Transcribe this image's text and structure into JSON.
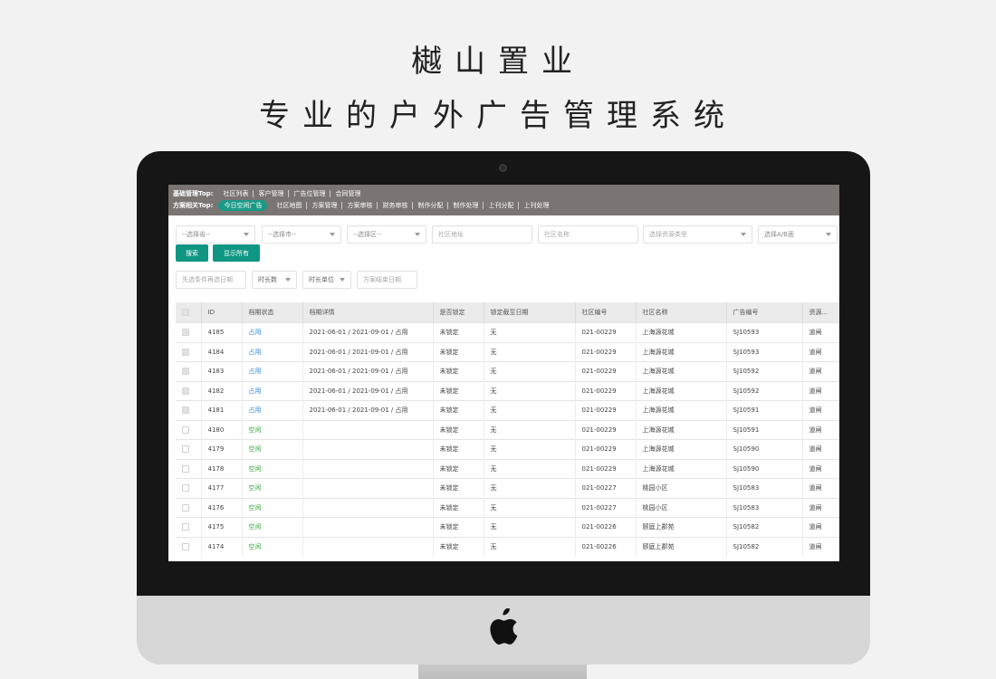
{
  "hero": {
    "title": "樾山置业",
    "subtitle": "专业的户外广告管理系统"
  },
  "colors": {
    "navbar_bg": "#7a7473",
    "accent": "#0f9683",
    "status_occupied": "#2f8ad8",
    "status_free": "#3aa83f"
  },
  "nav": {
    "row1_label": "基础管理Top:",
    "row1_links": [
      "社区列表",
      "客户管理",
      "广告位管理",
      "合同管理"
    ],
    "row2_label": "方案相关Top:",
    "row2_active": "今日空闲广告",
    "row2_links": [
      "社区地图",
      "方案管理",
      "方案审核",
      "财务审核",
      "制作分配",
      "制作处理",
      "上刊分配",
      "上刊处理"
    ]
  },
  "filters": {
    "province": "--选择省--",
    "city": "--选择市--",
    "district": "--选择区--",
    "address_placeholder": "社区地址",
    "name_placeholder": "社区名称",
    "resource_type": "选择资源类型",
    "ab_side": "选择A/B面",
    "search_button": "搜索",
    "show_all_button": "显示所有",
    "date_placeholder": "先选条件再选日期",
    "duration": "时长数",
    "duration_unit": "时长单位",
    "end_date_placeholder": "方案结束日期"
  },
  "table": {
    "columns": [
      "ID",
      "档期状态",
      "档期详情",
      "是否锁定",
      "锁定截至日期",
      "社区编号",
      "社区名称",
      "广告编号",
      "资源..."
    ],
    "rows": [
      {
        "id": "4185",
        "status": "占用",
        "detail": "2021-06-01 / 2021-09-01 / 占用",
        "locked": "未锁定",
        "lock_until": "无",
        "community_no": "021-00229",
        "community_name": "上海源花城",
        "ad_no": "SJ10593",
        "resource": "道闸",
        "selectable": false
      },
      {
        "id": "4184",
        "status": "占用",
        "detail": "2021-06-01 / 2021-09-01 / 占用",
        "locked": "未锁定",
        "lock_until": "无",
        "community_no": "021-00229",
        "community_name": "上海源花城",
        "ad_no": "SJ10593",
        "resource": "道闸",
        "selectable": false
      },
      {
        "id": "4183",
        "status": "占用",
        "detail": "2021-06-01 / 2021-09-01 / 占用",
        "locked": "未锁定",
        "lock_until": "无",
        "community_no": "021-00229",
        "community_name": "上海源花城",
        "ad_no": "SJ10592",
        "resource": "道闸",
        "selectable": false
      },
      {
        "id": "4182",
        "status": "占用",
        "detail": "2021-06-01 / 2021-09-01 / 占用",
        "locked": "未锁定",
        "lock_until": "无",
        "community_no": "021-00229",
        "community_name": "上海源花城",
        "ad_no": "SJ10592",
        "resource": "道闸",
        "selectable": false
      },
      {
        "id": "4181",
        "status": "占用",
        "detail": "2021-06-01 / 2021-09-01 / 占用",
        "locked": "未锁定",
        "lock_until": "无",
        "community_no": "021-00229",
        "community_name": "上海源花城",
        "ad_no": "SJ10591",
        "resource": "道闸",
        "selectable": false
      },
      {
        "id": "4180",
        "status": "空闲",
        "detail": "",
        "locked": "未锁定",
        "lock_until": "无",
        "community_no": "021-00229",
        "community_name": "上海源花城",
        "ad_no": "SJ10591",
        "resource": "道闸",
        "selectable": true
      },
      {
        "id": "4179",
        "status": "空闲",
        "detail": "",
        "locked": "未锁定",
        "lock_until": "无",
        "community_no": "021-00229",
        "community_name": "上海源花城",
        "ad_no": "SJ10590",
        "resource": "道闸",
        "selectable": true
      },
      {
        "id": "4178",
        "status": "空闲",
        "detail": "",
        "locked": "未锁定",
        "lock_until": "无",
        "community_no": "021-00229",
        "community_name": "上海源花城",
        "ad_no": "SJ10590",
        "resource": "道闸",
        "selectable": true
      },
      {
        "id": "4177",
        "status": "空闲",
        "detail": "",
        "locked": "未锁定",
        "lock_until": "无",
        "community_no": "021-00227",
        "community_name": "桃园小区",
        "ad_no": "SJ10583",
        "resource": "道闸",
        "selectable": true
      },
      {
        "id": "4176",
        "status": "空闲",
        "detail": "",
        "locked": "未锁定",
        "lock_until": "无",
        "community_no": "021-00227",
        "community_name": "桃园小区",
        "ad_no": "SJ10583",
        "resource": "道闸",
        "selectable": true
      },
      {
        "id": "4175",
        "status": "空闲",
        "detail": "",
        "locked": "未锁定",
        "lock_until": "无",
        "community_no": "021-00226",
        "community_name": "颐庭上郡苑",
        "ad_no": "SJ10582",
        "resource": "道闸",
        "selectable": true
      },
      {
        "id": "4174",
        "status": "空闲",
        "detail": "",
        "locked": "未锁定",
        "lock_until": "无",
        "community_no": "021-00226",
        "community_name": "颐庭上郡苑",
        "ad_no": "SJ10582",
        "resource": "道闸",
        "selectable": true
      }
    ]
  }
}
